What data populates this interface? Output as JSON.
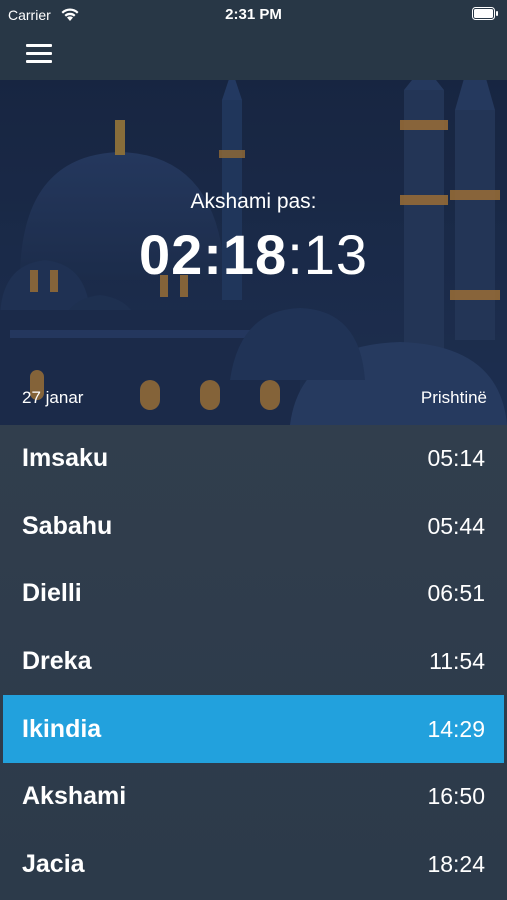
{
  "status_bar": {
    "carrier": "Carrier",
    "time": "2:31 PM"
  },
  "nav": {
    "menu_icon": "hamburger-menu-icon"
  },
  "hero": {
    "countdown_label": "Akshami pas:",
    "countdown_hm": "02:18",
    "countdown_sec": ":13",
    "date": "27 janar",
    "city": "Prishtinë"
  },
  "prayers": [
    {
      "name": "Imsaku",
      "time": "05:14",
      "active": false
    },
    {
      "name": "Sabahu",
      "time": "05:44",
      "active": false
    },
    {
      "name": "Dielli",
      "time": "06:51",
      "active": false
    },
    {
      "name": "Dreka",
      "time": "11:54",
      "active": false
    },
    {
      "name": "Ikindia",
      "time": "14:29",
      "active": true
    },
    {
      "name": "Akshami",
      "time": "16:50",
      "active": false
    },
    {
      "name": "Jacia",
      "time": "18:24",
      "active": false
    }
  ],
  "colors": {
    "active_row": "#22a1dd",
    "list_bg": "#313e4d",
    "bar_bg": "#283746"
  }
}
